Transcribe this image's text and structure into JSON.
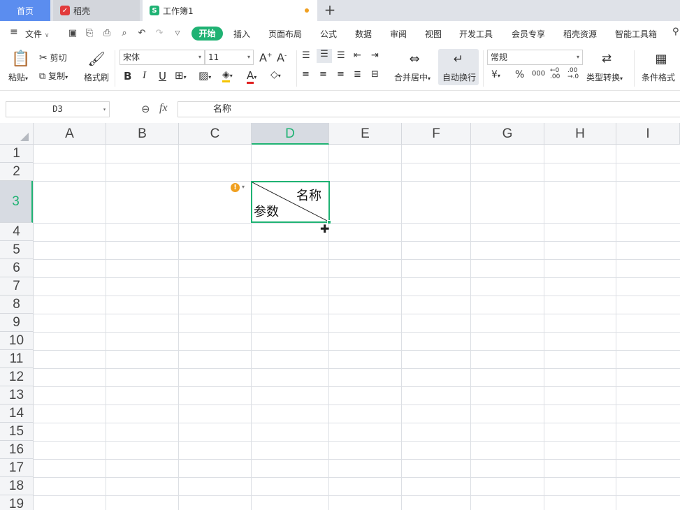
{
  "tabs": {
    "home": "首页",
    "daoke": "稻壳",
    "workbook": "工作簿1",
    "new_tab": "+"
  },
  "menu": {
    "file": "文件",
    "items": [
      "开始",
      "插入",
      "页面布局",
      "公式",
      "数据",
      "审阅",
      "视图",
      "开发工具",
      "会员专享",
      "稻壳资源",
      "智能工具箱"
    ]
  },
  "ribbon": {
    "paste": "粘贴",
    "cut": "剪切",
    "copy": "复制",
    "format_painter": "格式刷",
    "font_name": "宋体",
    "font_size": "11",
    "merge_center": "合并居中",
    "wrap_text": "自动换行",
    "number_format": "常规",
    "type_convert": "类型转换",
    "conditional_format": "条件格式",
    "currency": "¥",
    "percent": "%",
    "thousands": "000",
    "inc_decimal": "←0 .00",
    "dec_decimal": ".00 →.0"
  },
  "formula_bar": {
    "name_box": "D3",
    "fx": "fx",
    "content": "名称"
  },
  "grid": {
    "columns": [
      "A",
      "B",
      "C",
      "D",
      "E",
      "F",
      "G",
      "H",
      "I"
    ],
    "rows": [
      "1",
      "2",
      "3",
      "4",
      "5",
      "6",
      "7",
      "8",
      "9",
      "10",
      "11",
      "12",
      "13",
      "14",
      "15",
      "16",
      "17",
      "18",
      "19"
    ],
    "active_column": "D",
    "active_row": "3",
    "cell_d3_top_right": "名称",
    "cell_d3_bottom_left": "参数"
  },
  "colors": {
    "accent_green": "#1fb273",
    "tab_blue": "#5b8def",
    "warning_orange": "#f0a020"
  }
}
